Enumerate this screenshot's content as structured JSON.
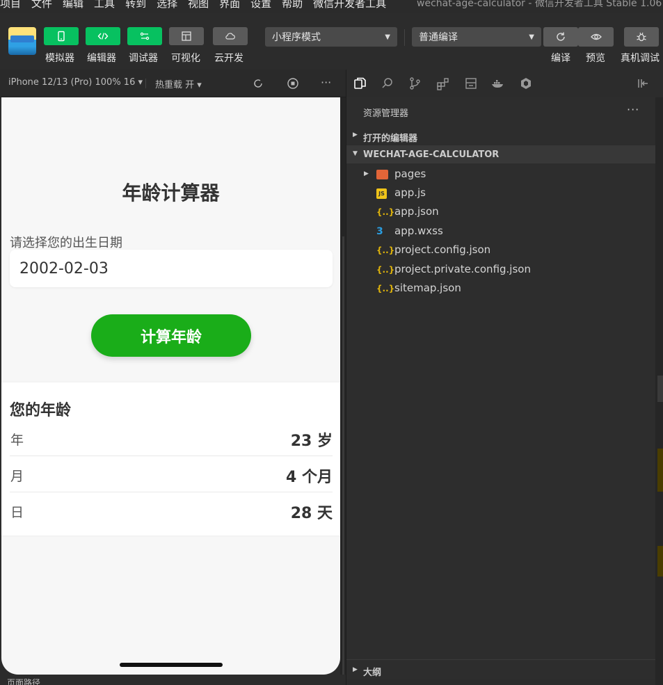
{
  "menubar": {
    "items": [
      "项目",
      "文件",
      "编辑",
      "工具",
      "转到",
      "选择",
      "视图",
      "界面",
      "设置",
      "帮助",
      "微信开发者工具"
    ],
    "window_title": "wechat-age-calculator - 微信开发者工具 Stable 1.06"
  },
  "toolbar": {
    "buttons": [
      {
        "label": "模拟器",
        "icon": "phone-icon"
      },
      {
        "label": "编辑器",
        "icon": "code-icon"
      },
      {
        "label": "调试器",
        "icon": "debug-toggle-icon"
      },
      {
        "label": "可视化",
        "icon": "layout-icon"
      },
      {
        "label": "云开发",
        "icon": "cloud-icon"
      }
    ],
    "mode_select": "小程序模式",
    "compile_select": "普通编译",
    "compile_label": "编译",
    "preview_label": "预览",
    "remote_debug_label": "真机调试"
  },
  "simulator": {
    "device": "iPhone 12/13 (Pro) 100% 16 ▾",
    "hot_reload": "热重载 开 ▾",
    "more": "···"
  },
  "app": {
    "title": "年龄计算器",
    "date_label": "请选择您的出生日期",
    "date_value": "2002-02-03",
    "button": "计算年龄",
    "result_title": "您的年龄",
    "rows": [
      {
        "key": "年",
        "value": "23 岁"
      },
      {
        "key": "月",
        "value": "4 个月"
      },
      {
        "key": "日",
        "value": "28 天"
      }
    ]
  },
  "statusbar": {
    "path": "页面路径"
  },
  "explorer": {
    "title": "资源管理器",
    "more": "···",
    "open_editors": "打开的编辑器",
    "project": "WECHAT-AGE-CALCULATOR",
    "files": [
      {
        "name": "pages",
        "icon": "folder-icon",
        "type": "folder"
      },
      {
        "name": "app.js",
        "icon": "js-file-icon",
        "type": "js"
      },
      {
        "name": "app.json",
        "icon": "json-file-icon",
        "type": "json"
      },
      {
        "name": "app.wxss",
        "icon": "css-file-icon",
        "type": "css"
      },
      {
        "name": "project.config.json",
        "icon": "json-file-icon",
        "type": "json"
      },
      {
        "name": "project.private.config.json",
        "icon": "json-file-icon",
        "type": "json"
      },
      {
        "name": "sitemap.json",
        "icon": "json-file-icon",
        "type": "json"
      }
    ],
    "outline": "大纲"
  }
}
